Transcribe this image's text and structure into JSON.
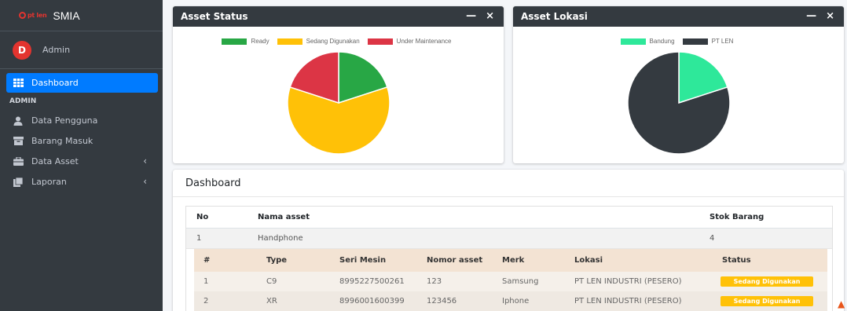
{
  "sidebar": {
    "brand_name": "SMIA",
    "brand_logo_text": "pt len",
    "user_initial": "D",
    "user_name": "Admin",
    "active_item": "Dashboard",
    "section_header": "ADMIN",
    "items": [
      {
        "label": "Data Pengguna",
        "icon": "user-icon"
      },
      {
        "label": "Barang Masuk",
        "icon": "box-icon"
      },
      {
        "label": "Data Asset",
        "icon": "briefcase-icon",
        "chevron": "‹"
      },
      {
        "label": "Laporan",
        "icon": "book-icon",
        "chevron": "‹"
      }
    ]
  },
  "status_card": {
    "title": "Asset Status",
    "minimize": "—",
    "close": "×",
    "chart_data": {
      "type": "pie",
      "categories": [
        "Ready",
        "Sedang Digunakan",
        "Under Maintenance"
      ],
      "values": [
        1,
        3,
        1
      ],
      "colors": [
        "#28a745",
        "#ffc107",
        "#dc3545"
      ],
      "legend": "top"
    }
  },
  "lokasi_card": {
    "title": "Asset Lokasi",
    "minimize": "—",
    "close": "×",
    "chart_data": {
      "type": "pie",
      "categories": [
        "Bandung",
        "PT LEN"
      ],
      "values": [
        1,
        4
      ],
      "colors": [
        "#2ee89a",
        "#343a40"
      ],
      "legend": "top"
    }
  },
  "dashboard": {
    "title": "Dashboard",
    "headers": {
      "no": "No",
      "nama": "Nama asset",
      "stok": "Stok Barang"
    },
    "group": {
      "no": "1",
      "nama": "Handphone",
      "stok": "4"
    },
    "sub_headers": {
      "idx": "#",
      "type": "Type",
      "seri": "Seri Mesin",
      "nomor": "Nomor asset",
      "merk": "Merk",
      "lokasi": "Lokasi",
      "status": "Status"
    },
    "rows": [
      {
        "idx": "1",
        "type": "C9",
        "seri": "8995227500261",
        "nomor": "123",
        "merk": "Samsung",
        "lokasi": "PT LEN INDUSTRI (PESERO)",
        "status": "Sedang Digunakan"
      },
      {
        "idx": "2",
        "type": "XR",
        "seri": "8996001600399",
        "nomor": "123456",
        "merk": "Iphone",
        "lokasi": "PT LEN INDUSTRI (PESERO)",
        "status": "Sedang Digunakan"
      }
    ]
  }
}
